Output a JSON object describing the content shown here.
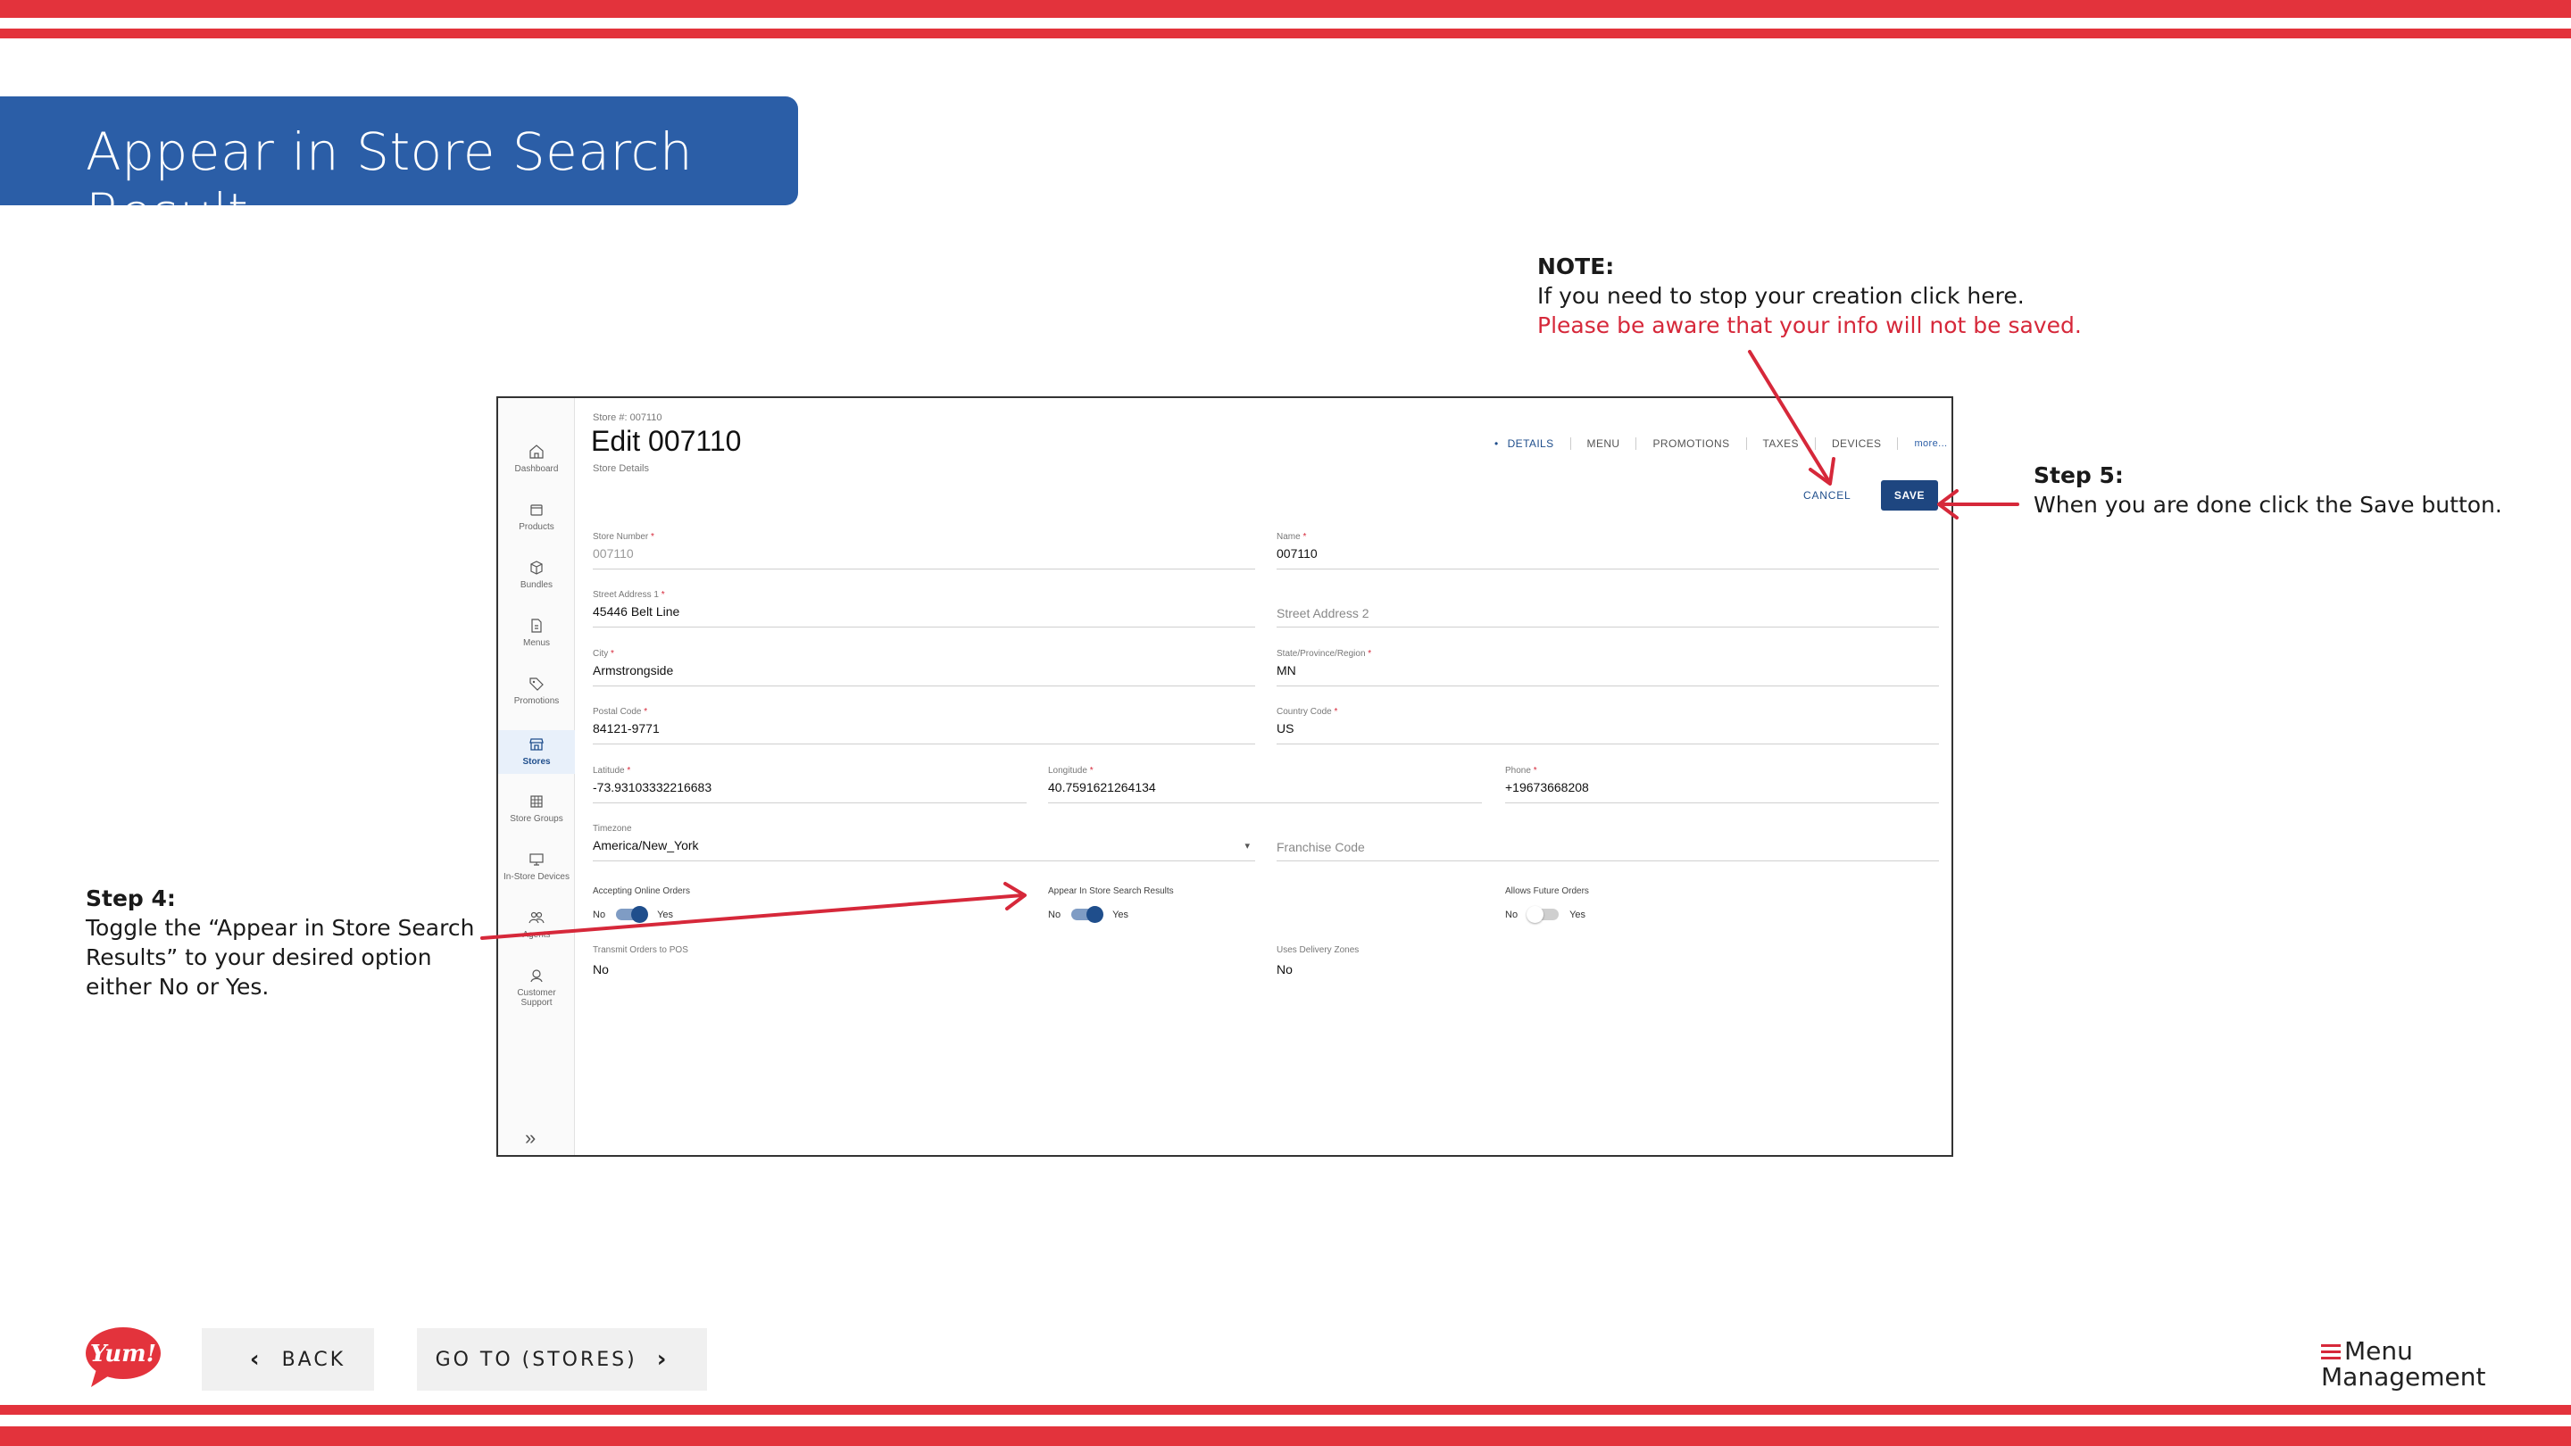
{
  "slide": {
    "title": "Appear in Store Search Result",
    "note_heading": "NOTE:",
    "note_line1": "If you need to stop your creation click here.",
    "note_line2": "Please be aware that your info will not be saved.",
    "step5_heading": "Step 5:",
    "step5_text": "When you are done click the Save button.",
    "step4_heading": "Step 4:",
    "step4_text": "Toggle the “Appear in Store Search Results” to your desired option either No or Yes.",
    "back_label": "BACK",
    "goto_label": "GO TO (STORES)",
    "yum_logo": "Yum!",
    "logo_line1": "Menu",
    "logo_line2": "Management",
    "accent_color": "#e3333c",
    "title_bg": "#2b5ea7"
  },
  "app": {
    "sidebar": [
      {
        "label": "Dashboard",
        "icon": "home-icon"
      },
      {
        "label": "Products",
        "icon": "box-icon"
      },
      {
        "label": "Bundles",
        "icon": "cube-icon"
      },
      {
        "label": "Menus",
        "icon": "document-icon"
      },
      {
        "label": "Promotions",
        "icon": "tag-icon"
      },
      {
        "label": "Stores",
        "icon": "storefront-icon"
      },
      {
        "label": "Store Groups",
        "icon": "grid-icon"
      },
      {
        "label": "In-Store Devices",
        "icon": "monitor-icon"
      },
      {
        "label": "Agents",
        "icon": "people-icon"
      },
      {
        "label": "Customer Support",
        "icon": "support-icon"
      }
    ],
    "store_number_caption": "Store #: 007110",
    "title": "Edit 007110",
    "subtitle": "Store Details",
    "tabs": [
      "DETAILS",
      "MENU",
      "PROMOTIONS",
      "TAXES",
      "DEVICES",
      "more..."
    ],
    "cancel_label": "CANCEL",
    "save_label": "SAVE",
    "fields": {
      "store_number": {
        "label": "Store Number",
        "value": "007110"
      },
      "name": {
        "label": "Name",
        "value": "007110"
      },
      "street1": {
        "label": "Street Address 1",
        "value": "45446 Belt Line"
      },
      "street2": {
        "placeholder": "Street Address 2"
      },
      "city": {
        "label": "City",
        "value": "Armstrongside"
      },
      "state": {
        "label": "State/Province/Region",
        "value": "MN"
      },
      "postal": {
        "label": "Postal Code",
        "value": "84121-9771"
      },
      "country": {
        "label": "Country Code",
        "value": "US"
      },
      "latitude": {
        "label": "Latitude",
        "value": "-73.93103332216683"
      },
      "longitude": {
        "label": "Longitude",
        "value": "40.7591621264134"
      },
      "phone": {
        "label": "Phone",
        "value": "+19673668208"
      },
      "timezone": {
        "label": "Timezone",
        "value": "America/New_York"
      },
      "franchise": {
        "placeholder": "Franchise Code"
      }
    },
    "toggles": {
      "online": {
        "label": "Accepting Online Orders",
        "no": "No",
        "yes": "Yes",
        "state": "on"
      },
      "search": {
        "label": "Appear In Store Search Results",
        "no": "No",
        "yes": "Yes",
        "state": "on"
      },
      "future": {
        "label": "Allows Future Orders",
        "no": "No",
        "yes": "Yes",
        "state": "off"
      }
    },
    "readonly": {
      "pos": {
        "label": "Transmit Orders to POS",
        "value": "No"
      },
      "delivery": {
        "label": "Uses Delivery Zones",
        "value": "No"
      }
    }
  }
}
